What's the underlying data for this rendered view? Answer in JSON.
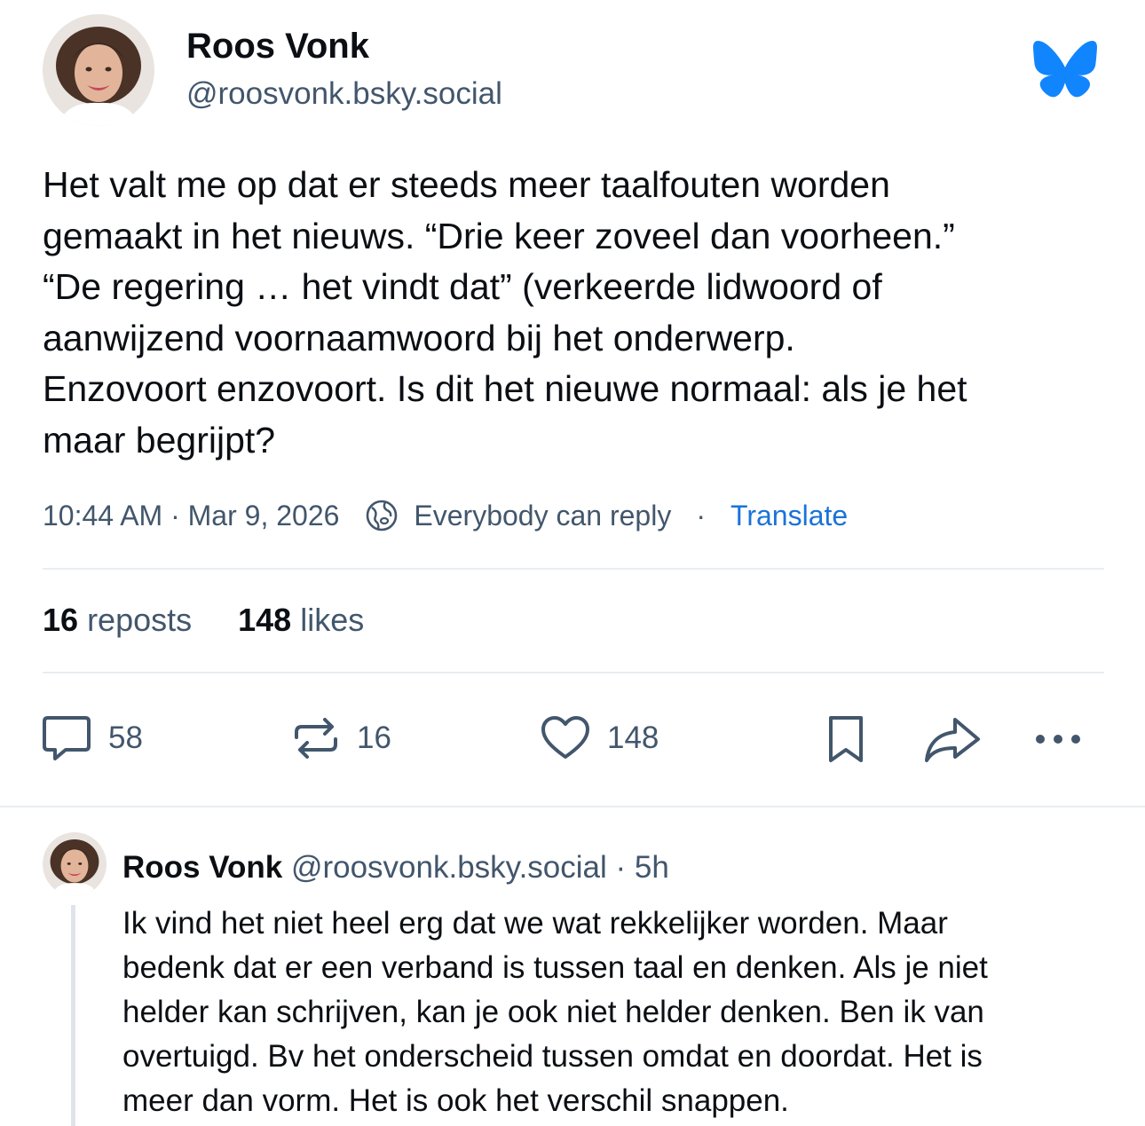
{
  "post": {
    "author": {
      "name": "Roos Vonk",
      "handle": "@roosvonk.bsky.social"
    },
    "text": "Het valt me op dat er steeds meer taalfouten worden\ngemaakt in het nieuws. “Drie keer zoveel dan voorheen.”\n“De regering … het vindt dat” (verkeerde lidwoord of\naanwijzend voornaamwoord bij het onderwerp.\nEnzovoort enzovoort. Is dit het nieuwe normaal: als je het\nmaar begrijpt?",
    "timestamp": "10:44 AM · Mar 9, 2026",
    "reply_setting": "Everybody can reply",
    "separator": "·",
    "translate_label": "Translate",
    "stats": {
      "reposts_count": "16",
      "reposts_label": "reposts",
      "likes_count": "148",
      "likes_label": "likes"
    },
    "actions": {
      "reply_count": "58",
      "repost_count": "16",
      "like_count": "148"
    }
  },
  "reply": {
    "author_name": "Roos Vonk",
    "handle": "@roosvonk.bsky.social",
    "time": "· 5h",
    "text": "Ik vind het niet heel erg dat we wat rekkelijker worden. Maar\nbedenk dat er een verband is tussen taal en denken. Als je niet\nhelder kan schrijven, kan je ook niet helder denken. Ben ik van\novertuigd. Bv het onderscheid tussen omdat en doordat. Het is\nmeer dan vorm. Het is ook het verschil snappen."
  },
  "icons": {
    "logo": "butterfly-icon",
    "reply_setting": "globe-icon",
    "reply": "speech-bubble-icon",
    "repost": "repost-arrows-icon",
    "like": "heart-outline-icon",
    "bookmark": "bookmark-icon",
    "share": "share-arrow-icon",
    "more": "ellipsis-icon"
  },
  "colors": {
    "text_primary": "#0b0f14",
    "text_secondary": "#42566c",
    "link": "#1a73d8",
    "brand": "#1185fe",
    "divider": "#e9edf1"
  }
}
